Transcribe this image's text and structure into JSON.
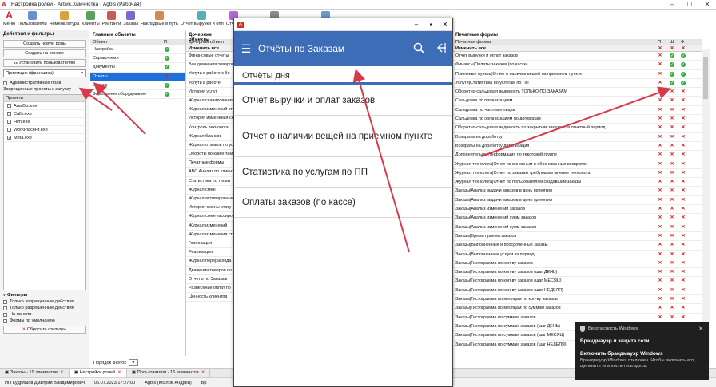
{
  "window": {
    "title": "Настройка ролей · Агбис.Химчистка · Agbis (Рабочая)"
  },
  "ribbon": {
    "menu": "Меню",
    "buttons": [
      "Пользователи",
      "Номенклатура",
      "Клиенты",
      "Рейтинги",
      "Заказы",
      "Накладные в путь",
      "Отчет выручки и опл",
      "Отчёты",
      "Статистика по услугам по ПП",
      "Печатные формы"
    ]
  },
  "left": {
    "header": "Действия и фильтры",
    "btn_create_role": "Создать новую роль",
    "btn_create_based": "Создать на основе",
    "btn_install_users": "Установить пользователям",
    "role_select": "Приемщик (франшиза)",
    "admin_rights": "Административные прав",
    "forbidden_header": "Запрещенные проекты к запуску",
    "projects_header": "Проекты",
    "projects": [
      {
        "name": "AnalBiz.exe",
        "checked": false
      },
      {
        "name": "Calls.exe",
        "checked": false
      },
      {
        "name": "Him.exe",
        "checked": false
      },
      {
        "name": "WorkPlacePr.exe",
        "checked": false
      },
      {
        "name": "Meta.exe",
        "checked": true
      }
    ],
    "filters_header": "Фильтры",
    "filters": [
      "Только запрещенные действия",
      "Только разрешенные действия",
      "На панели",
      "Формы по умолчанию"
    ],
    "reset_filters": "Сбросить фильтры"
  },
  "main_objects": {
    "header": "Главные объекты",
    "col_object": "Объект",
    "col_p": "П",
    "rows": [
      {
        "name": "Настройки",
        "mark": "ok"
      },
      {
        "name": "Справочники",
        "mark": "ok"
      },
      {
        "name": "Документы",
        "mark": "ok"
      },
      {
        "name": "Отчеты",
        "mark": "x",
        "selected": true
      },
      {
        "name": "Сервис",
        "mark": "ok"
      },
      {
        "name": "Фискальное оборудование",
        "mark": "ok"
      }
    ]
  },
  "child_objects": {
    "header": "Дочерние объекты",
    "col_object": "Дочерний объект",
    "edit_all": "Изменить все",
    "rows": [
      "Финансовые отчеты",
      "Все движения товаров",
      "Услуги в работе с бо",
      "Услуги в работе",
      "История услуг",
      "Журнал сканирования",
      "Журнал изменений ст",
      "История изменения ск",
      "Контроль технолога",
      "Журнал бланков",
      "Журнал отзывов по ус",
      "Обороты по клиентам",
      "Печатные формы",
      "ABC Анализ по клиент",
      "Статистика по типам",
      "Журнал смен",
      "Журнал активирования",
      "История смены стату",
      "Журнал смен кассиров",
      "Журнал изменений",
      "Журнал изменения ст",
      "Геолокация",
      "Реализация",
      "Журнал перерасхода",
      "Движения товаров по",
      "Отчеты по Заказам",
      "Разнесение оплат по",
      "Ценность клиентов"
    ]
  },
  "order_label": "Порядок кнопок",
  "print_forms": {
    "header": "Печатные формы",
    "col_form": "Печатная форма",
    "cols": [
      "П",
      "Ш",
      "Ф"
    ],
    "edit_all": "Изменить все",
    "rows": [
      {
        "name": "Отчет выручки и оплат заказов",
        "m": [
          "x",
          "ok",
          "ok"
        ]
      },
      {
        "name": "Финансы|Оплаты заказов (по кассе)",
        "m": [
          "x",
          "ok",
          "ok"
        ]
      },
      {
        "name": "Приемные пункты|Отчет о наличии вещей на приемном пункте",
        "m": [
          "x",
          "ok",
          "ok"
        ]
      },
      {
        "name": "Услуги|Статистика по услугам по ПП",
        "m": [
          "x",
          "ok",
          "ok"
        ]
      },
      {
        "name": "Оборотно-сальдовая ведомость ТОЛЬКО ПО ЗАКАЗАМ",
        "m": [
          "x",
          "x",
          "x"
        ]
      },
      {
        "name": "Сальдовка по организациям",
        "m": [
          "x",
          "x",
          "x"
        ]
      },
      {
        "name": "Сальдовка по частным лицам",
        "m": [
          "x",
          "x",
          "x"
        ]
      },
      {
        "name": "Сальдовка по организациям по договорам",
        "m": [
          "x",
          "x",
          "x"
        ]
      },
      {
        "name": "Оборотно-сальдовая ведомость по закрытым заказам за отчетный период",
        "m": [
          "x",
          "x",
          "x"
        ]
      },
      {
        "name": "Возвраты на доработку",
        "m": [
          "x",
          "x",
          "x"
        ]
      },
      {
        "name": "Возвраты на доработку детализация",
        "m": [
          "x",
          "x",
          "x"
        ]
      },
      {
        "name": "Дополнительная информация по текстовой группе",
        "m": [
          "x",
          "x",
          "x"
        ]
      },
      {
        "name": "Журнал технолога|Отчет по виновным в обоснованных возвратах",
        "m": [
          "x",
          "x",
          "x"
        ]
      },
      {
        "name": "Журнал технолога|Отчет по заказам требующим мнение технолога",
        "m": [
          "x",
          "x",
          "x"
        ]
      },
      {
        "name": "Журнал технолога|Отчет по пользователям создавшим заказы",
        "m": [
          "x",
          "x",
          "x"
        ]
      },
      {
        "name": "Заказы|Анализ выдачи заказов в день принятия",
        "m": [
          "x",
          "x",
          "x"
        ]
      },
      {
        "name": "Заказы|Анализ выдачи заказов в день принятия",
        "m": [
          "x",
          "x",
          "x"
        ]
      },
      {
        "name": "Заказы|Анализ изменений заказов",
        "m": [
          "x",
          "x",
          "x"
        ]
      },
      {
        "name": "Заказы|Анализ изменений сумм заказов",
        "m": [
          "x",
          "x",
          "x"
        ]
      },
      {
        "name": "Заказы|Анализ изменений сумм заказов",
        "m": [
          "x",
          "x",
          "x"
        ]
      },
      {
        "name": "Заказы|Время приема заказов",
        "m": [
          "x",
          "x",
          "x"
        ]
      },
      {
        "name": "Заказы|Выполненные и просроченные заказы",
        "m": [
          "x",
          "x",
          "x"
        ]
      },
      {
        "name": "Заказы|Выполненные услуги за период",
        "m": [
          "x",
          "x",
          "x"
        ]
      },
      {
        "name": "Заказы|Гистограмма по кол-ву заказов",
        "m": [
          "x",
          "x",
          "x"
        ]
      },
      {
        "name": "Заказы|Гистограмма по кол-ву заказов (шаг ДЕНЬ)",
        "m": [
          "x",
          "x",
          "x"
        ]
      },
      {
        "name": "Заказы|Гистограмма по кол-ву заказов (шаг МЕСЯЦ)",
        "m": [
          "x",
          "x",
          "x"
        ]
      },
      {
        "name": "Заказы|Гистограмма по кол-ву заказов (шаг НЕДЕЛЯ)",
        "m": [
          "x",
          "x",
          "x"
        ]
      },
      {
        "name": "Заказы|Гистограмма по месяцам по кол-ву заказов",
        "m": [
          "x",
          "x",
          "x"
        ]
      },
      {
        "name": "Заказы|Гистограмма по месяцам по суммам заказов",
        "m": [
          "x",
          "x",
          "x"
        ]
      },
      {
        "name": "Заказы|Гистограмма по суммам заказов",
        "m": [
          "x",
          "x",
          "x"
        ]
      },
      {
        "name": "Заказы|Гистограмма по суммам заказов (шаг ДЕНЬ)",
        "m": [
          "x",
          "x",
          "x"
        ]
      },
      {
        "name": "Заказы|Гистограмма по суммам заказов (шаг МЕСЯЦ)",
        "m": [
          "x",
          "x",
          "x"
        ]
      },
      {
        "name": "Заказы|Гистограмма по суммам заказов (шаг НЕДЕЛЯ)",
        "m": [
          "x",
          "x",
          "x"
        ]
      }
    ]
  },
  "tabs": [
    {
      "label": "Заказы - 19 элементов",
      "active": false
    },
    {
      "label": "Настройки ролей",
      "active": true
    },
    {
      "label": "Пользователи - 16 элементов",
      "active": false
    }
  ],
  "status": [
    "ИП Кудряшов Дмитрий Владимирович",
    "06.07.2023 17:27:00",
    "Agbis (Козлов Андрей)",
    "Вр"
  ],
  "phone": {
    "title": "Отчёты по Заказам",
    "section": "Отчёты дня",
    "items": [
      "Отчет выручки и оплат заказов",
      "Отчет о наличии вещей на приемном пункте",
      "Статистика по услугам по ПП",
      "Оплаты заказов (по кассе)"
    ]
  },
  "toast": {
    "app": "Безопасность Windows",
    "line1": "Брандмауэр и защита сети",
    "line2": "Включить брандмауэр Windows",
    "line3": "Брандмауэр Windows отключен. Чтобы включить его, щелкните или коснитесь здесь."
  },
  "colors": {
    "accent": "#3e6db8",
    "selection": "#1e6fd9",
    "arrow": "#d93a4a",
    "deny": "#d62020",
    "allow": "#2fae3a"
  }
}
